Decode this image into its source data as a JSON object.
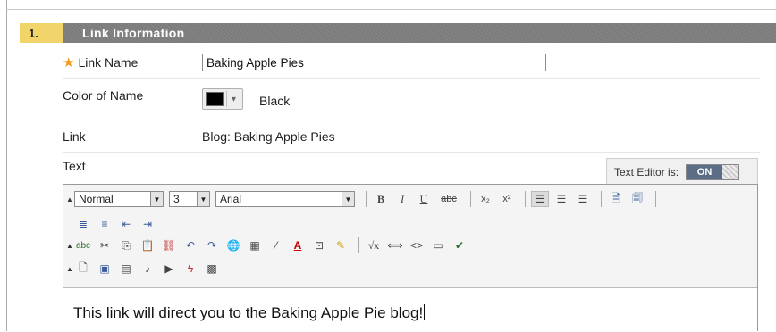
{
  "step": {
    "number": "1.",
    "title": "Link Information"
  },
  "fields": {
    "link_name_label": "Link Name",
    "link_name_value": "Baking Apple Pies",
    "color_label": "Color of Name",
    "color_value_name": "Black",
    "color_value_hex": "#000000",
    "link_label": "Link",
    "link_value": "Blog: Baking Apple Pies",
    "text_label": "Text"
  },
  "text_editor": {
    "status_label": "Text Editor is:",
    "status_value": "ON"
  },
  "toolbar": {
    "format_select": "Normal",
    "size_select": "3",
    "font_select": "Arial"
  },
  "editor_content": "This link will direct you to the Baking Apple Pie blog!",
  "colors": {
    "accent": "#f39a1e",
    "header_bg": "#7c7c7c",
    "step_num_bg": "#f2d56a",
    "toggle_on": "#5b6e86"
  }
}
